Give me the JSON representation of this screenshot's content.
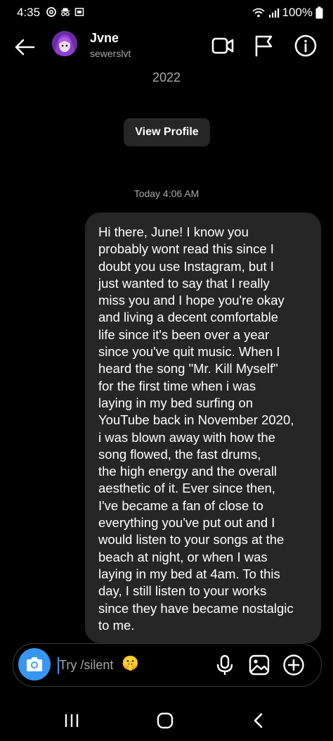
{
  "status_bar": {
    "time": "4:35",
    "battery": "100%",
    "icons": [
      "threads-icon",
      "incognito-icon",
      "gallery-icon",
      "wifi-icon",
      "signal-icon"
    ]
  },
  "header": {
    "name": "Jvne",
    "username": "sewerslvt",
    "icons": [
      "back-arrow-icon",
      "video-call-icon",
      "flag-icon",
      "info-icon"
    ]
  },
  "conversation": {
    "year_label": "2022",
    "view_profile_label": "View Profile",
    "timestamp": "Today 4:06 AM",
    "messages": [
      {
        "sender": "me",
        "text": "Hi there, June! I know you\nprobably wont read this since I\ndoubt you use Instagram, but I\njust wanted to say that I really\nmiss you and I hope you're okay\nand living a decent comfortable\nlife since it's been over a year\nsince you've quit music. When I\nheard the song \"Mr. Kill Myself\"\nfor the first time when i was\nlaying in my bed surfing on\nYouTube back in November 2020,\ni was blown away with how the\nsong flowed, the fast drums,\nthe high energy and the overall\naesthetic of it. Ever since then,\nI've became a fan of close to\neverything you've put out and I\nwould listen to your songs at the\nbeach at night, or when I was\nlaying in my bed at 4am. To this\nday, I still listen to your works\nsince they have became nostalgic\nto me."
      }
    ]
  },
  "composer": {
    "placeholder": "Try /silent",
    "emoji": "🤫",
    "accent_color": "#3797f0",
    "icons": [
      "camera-icon",
      "microphone-icon",
      "image-icon",
      "plus-circle-icon"
    ]
  },
  "nav_bar": {
    "icons": [
      "recents-icon",
      "home-icon",
      "back-icon"
    ]
  }
}
